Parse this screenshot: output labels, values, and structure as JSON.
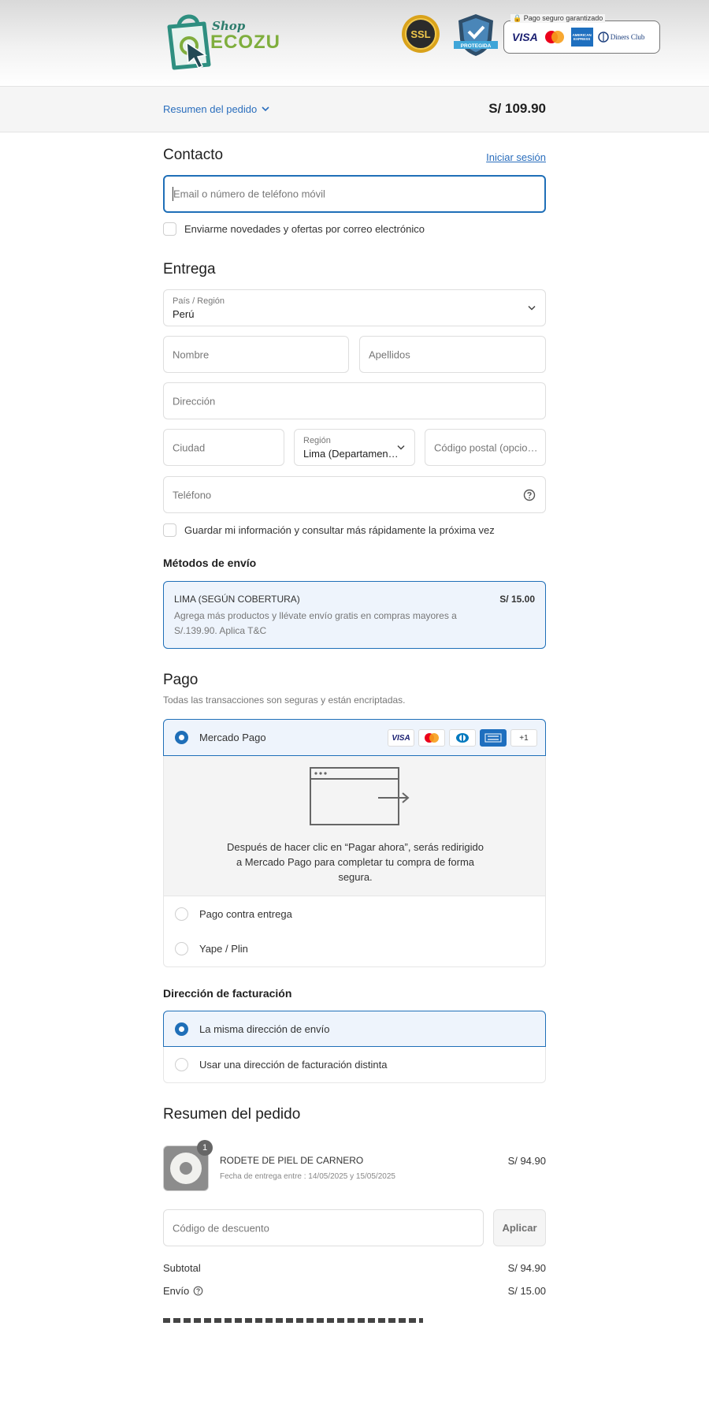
{
  "header": {
    "logo_shop": "Shop",
    "logo_name": "ECOZU",
    "ssl_badge": "SSL",
    "protected_badge": "PROTEGIDA",
    "secure_payment_label": "Pago seguro garantizado",
    "payment_brands": [
      "VISA",
      "AMERICAN EXPRESS",
      "Diners Club"
    ]
  },
  "summary_bar": {
    "toggle_label": "Resumen del pedido",
    "total": "S/ 109.90"
  },
  "contact": {
    "title": "Contacto",
    "login_link": "Iniciar sesión",
    "email_placeholder": "Email o número de teléfono móvil",
    "newsletter_label": "Enviarme novedades y ofertas por correo electrónico"
  },
  "delivery": {
    "title": "Entrega",
    "country_label": "País / Región",
    "country_value": "Perú",
    "first_name_placeholder": "Nombre",
    "last_name_placeholder": "Apellidos",
    "address_placeholder": "Dirección",
    "city_placeholder": "Ciudad",
    "region_label": "Región",
    "region_value": "Lima (Departamen…",
    "postal_placeholder": "Código postal (opcio…",
    "phone_placeholder": "Teléfono",
    "save_info_label": "Guardar mi información y consultar más rápidamente la próxima vez"
  },
  "shipping": {
    "title": "Métodos de envío",
    "option_name": "LIMA (SEGÚN COBERTURA)",
    "option_price": "S/ 15.00",
    "option_desc": "Agrega más productos y llévate envío gratis en compras mayores a S/.139.90. Aplica T&C"
  },
  "payment": {
    "title": "Pago",
    "subtitle": "Todas las transacciones son seguras y están encriptadas.",
    "mercado_pago_label": "Mercado Pago",
    "card_visa": "VISA",
    "card_more": "+1",
    "redirect_text": "Después de hacer clic en “Pagar ahora”, serás redirigido a Mercado Pago para completar tu compra de forma segura.",
    "cod_label": "Pago contra entrega",
    "yape_label": "Yape / Plin"
  },
  "billing": {
    "title": "Dirección de facturación",
    "same_label": "La misma dirección de envío",
    "different_label": "Usar una dirección de facturación distinta"
  },
  "order_summary": {
    "title": "Resumen del pedido",
    "item_qty": "1",
    "item_name": "RODETE DE PIEL DE CARNERO",
    "item_delivery": "Fecha de entrega entre : 14/05/2025 y 15/05/2025",
    "item_price": "S/ 94.90",
    "discount_placeholder": "Código de descuento",
    "apply_label": "Aplicar",
    "subtotal_label": "Subtotal",
    "subtotal_value": "S/ 94.90",
    "shipping_label": "Envío",
    "shipping_value": "S/ 15.00"
  },
  "colors": {
    "accent": "#1f6fb8",
    "link": "#2a6ebd",
    "brand_green": "#7fae3d",
    "brand_teal": "#2e7d6d"
  }
}
